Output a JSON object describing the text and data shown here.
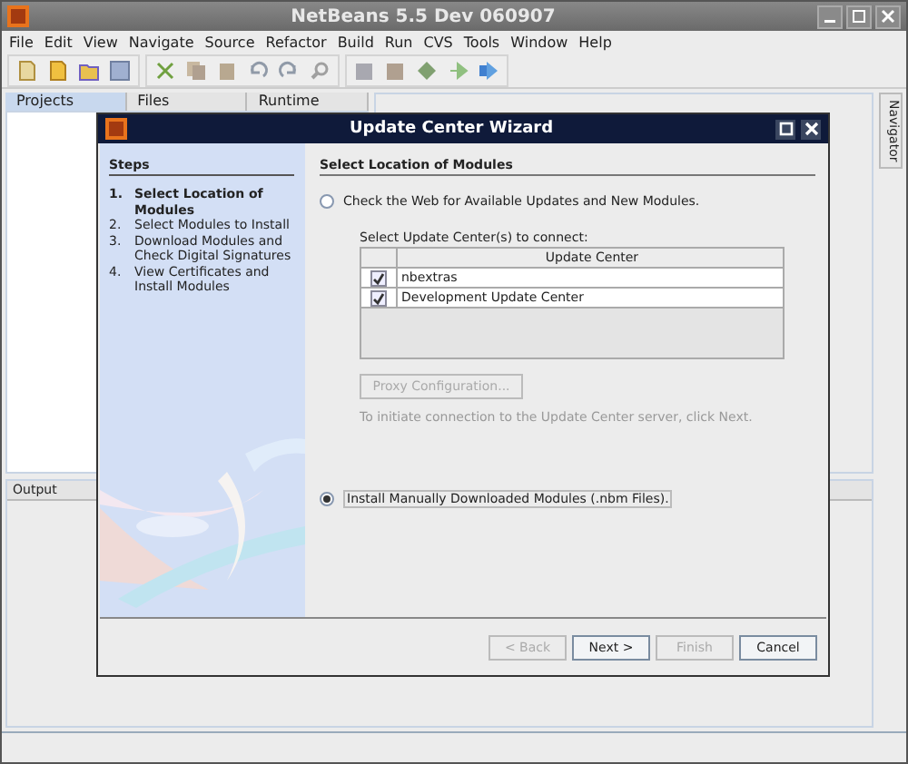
{
  "window": {
    "title": "NetBeans 5.5 Dev 060907"
  },
  "menu": [
    "File",
    "Edit",
    "View",
    "Navigate",
    "Source",
    "Refactor",
    "Build",
    "Run",
    "CVS",
    "Tools",
    "Window",
    "Help"
  ],
  "panel_tabs": [
    {
      "label": "Projects",
      "selected": true
    },
    {
      "label": "Files",
      "selected": false
    },
    {
      "label": "Runtime",
      "selected": false
    }
  ],
  "side_tab": {
    "label": "Navigator"
  },
  "output_tab": {
    "label": "Output"
  },
  "dialog": {
    "title": "Update Center Wizard",
    "steps_heading": "Steps",
    "steps": [
      {
        "number": "1.",
        "label": "Select Location of Modules",
        "selected": true
      },
      {
        "number": "2.",
        "label": "Select Modules to Install",
        "selected": false
      },
      {
        "number": "3.",
        "label": "Download Modules and Check Digital Signatures",
        "selected": false
      },
      {
        "number": "4.",
        "label": "View Certificates and Install Modules",
        "selected": false
      }
    ],
    "heading": "Select Location of Modules",
    "options": [
      {
        "label": "Check the Web for Available Updates and New Modules.",
        "selected": false
      },
      {
        "label": "Install Manually Downloaded Modules (.nbm Files).",
        "selected": true
      }
    ],
    "table_label": "Select Update Center(s) to connect:",
    "table": {
      "columns": [
        "Update Center"
      ],
      "rows": [
        {
          "checked": true,
          "name": "nbextras"
        },
        {
          "checked": true,
          "name": "Development Update Center"
        }
      ]
    },
    "proxy_button": {
      "label": "Proxy Configuration...",
      "disabled": true
    },
    "hint": "To initiate connection to the Update Center server, click Next.",
    "buttons": [
      {
        "label": "< Back",
        "disabled": true
      },
      {
        "label": "Next >",
        "disabled": false
      },
      {
        "label": "Finish",
        "disabled": true
      },
      {
        "label": "Cancel",
        "disabled": false
      }
    ]
  }
}
